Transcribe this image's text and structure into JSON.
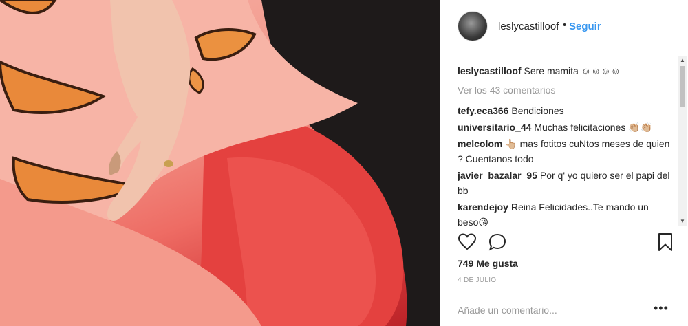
{
  "post": {
    "username": "leslycastilloof",
    "follow_label": "Seguir",
    "caption": "Sere mamita ☺☺☺☺",
    "view_all_label": "Ver los 43 comentarios",
    "likes": "749 Me gusta",
    "date": "4 DE JULIO",
    "add_comment_placeholder": "Añade un comentario...",
    "more_label": "•••"
  },
  "comments": [
    {
      "user": "tefy.eca366",
      "text": "Bendiciones"
    },
    {
      "user": "universitario_44",
      "text": "Muchas felicitaciones 👏🏼👏🏼"
    },
    {
      "user": "melcolom",
      "text": "👆🏼 mas fotitos cuNtos meses de quien ? Cuentanos todo"
    },
    {
      "user": "javier_bazalar_95",
      "text": "Por q' yo quiero ser el papi del bb"
    },
    {
      "user": "karendejoy",
      "text": "Reina Felicidades..Te mando un beso😘"
    }
  ],
  "icons": {
    "heart": "heart-icon",
    "comment": "comment-icon",
    "bookmark": "bookmark-icon",
    "avatar": "avatar"
  },
  "colors": {
    "link": "#3897f0",
    "text": "#262626",
    "muted": "#999999"
  }
}
